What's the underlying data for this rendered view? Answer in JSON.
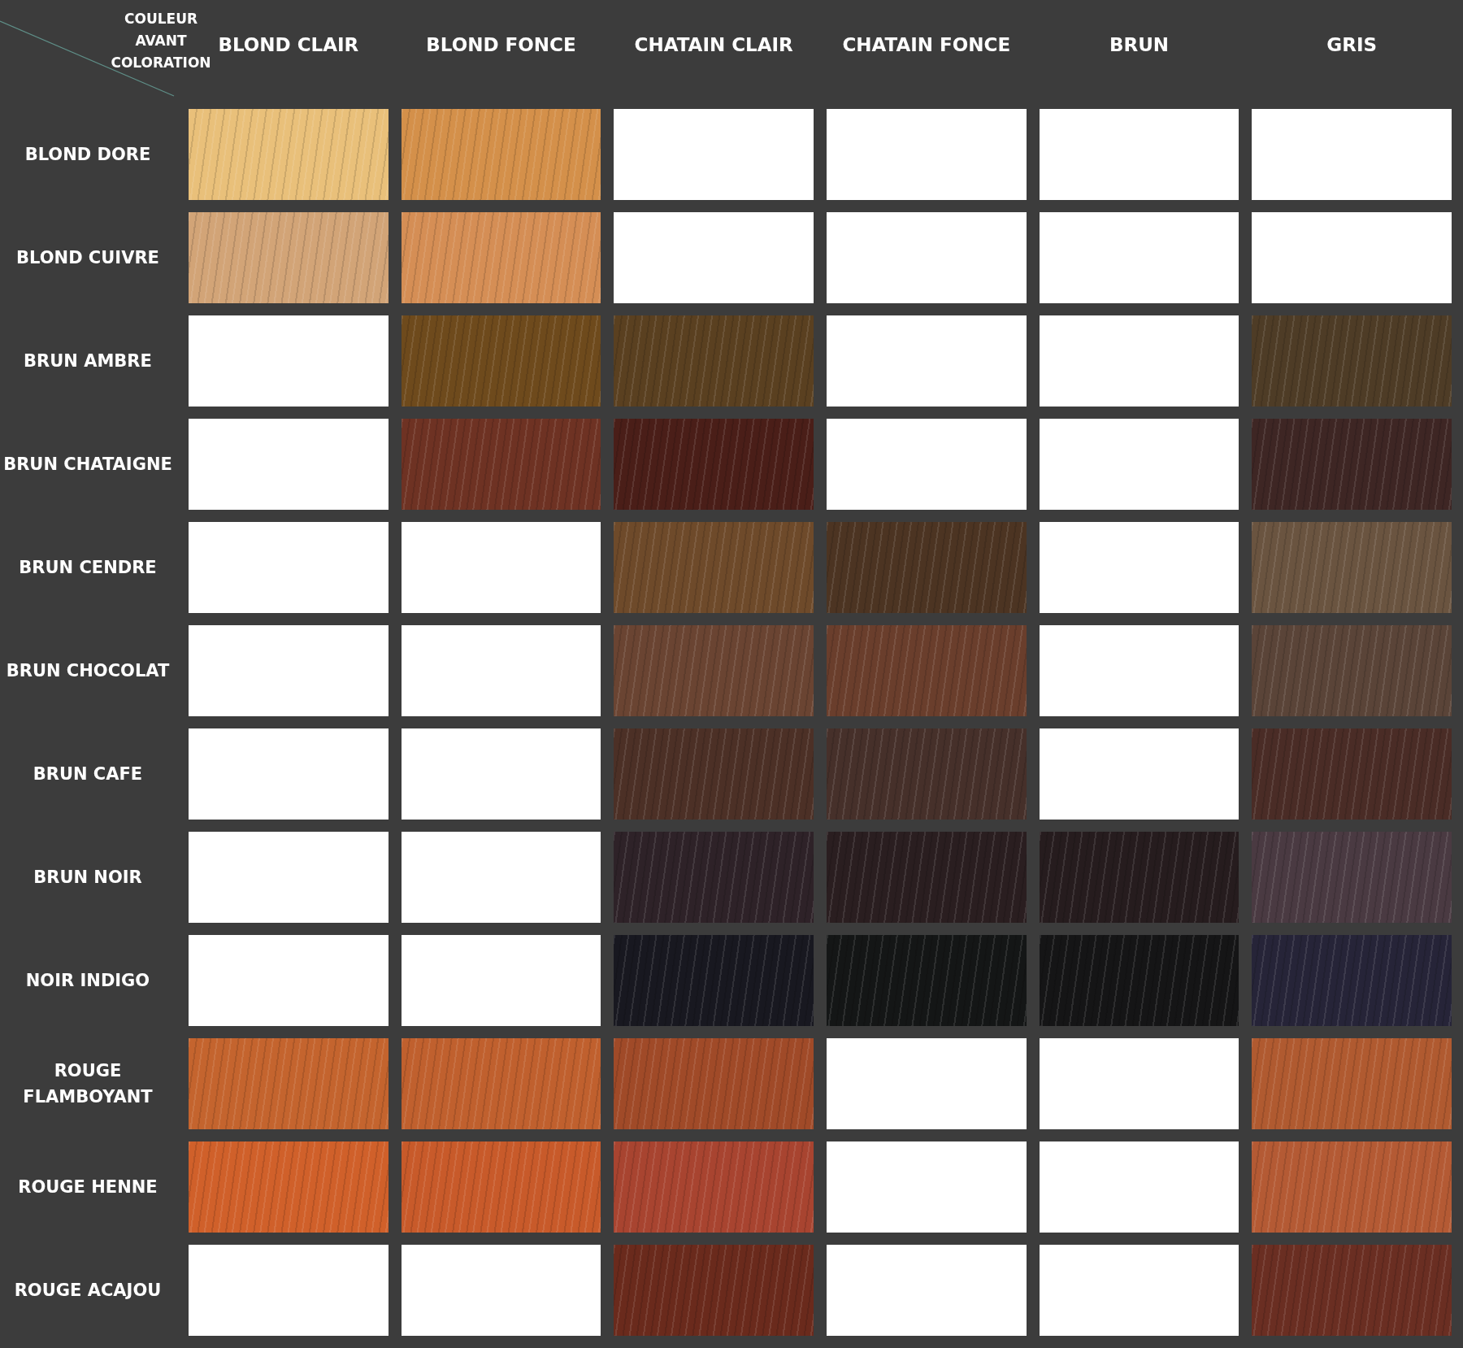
{
  "corner_label": "COULEUR AVANT COLORATION",
  "columns": [
    "BLOND CLAIR",
    "BLOND FONCE",
    "CHATAIN CLAIR",
    "CHATAIN FONCE",
    "BRUN",
    "GRIS"
  ],
  "rows": [
    {
      "label": "BLOND DORE",
      "cells": [
        {
          "kind": "swatch",
          "color": "#e9c07a"
        },
        {
          "kind": "swatch",
          "color": "#d4904a"
        },
        {
          "kind": "empty"
        },
        {
          "kind": "empty"
        },
        {
          "kind": "empty"
        },
        {
          "kind": "empty"
        }
      ]
    },
    {
      "label": "BLOND CUIVRE",
      "cells": [
        {
          "kind": "swatch",
          "color": "#d2a477"
        },
        {
          "kind": "swatch",
          "color": "#d58e55"
        },
        {
          "kind": "empty"
        },
        {
          "kind": "empty"
        },
        {
          "kind": "empty"
        },
        {
          "kind": "empty"
        }
      ]
    },
    {
      "label": "BRUN AMBRE",
      "cells": [
        {
          "kind": "empty"
        },
        {
          "kind": "swatch",
          "color": "#6e4a1c"
        },
        {
          "kind": "swatch",
          "color": "#5a4020"
        },
        {
          "kind": "empty"
        },
        {
          "kind": "empty"
        },
        {
          "kind": "swatch",
          "color": "#4e3c26"
        }
      ]
    },
    {
      "label": "BRUN CHATAIGNE",
      "cells": [
        {
          "kind": "empty"
        },
        {
          "kind": "swatch",
          "color": "#6e3223"
        },
        {
          "kind": "swatch",
          "color": "#4a1e18"
        },
        {
          "kind": "empty"
        },
        {
          "kind": "empty"
        },
        {
          "kind": "swatch",
          "color": "#3e2624"
        }
      ]
    },
    {
      "label": "BRUN CENDRE",
      "cells": [
        {
          "kind": "empty"
        },
        {
          "kind": "empty"
        },
        {
          "kind": "swatch",
          "color": "#6e4a2a"
        },
        {
          "kind": "swatch",
          "color": "#4c3422"
        },
        {
          "kind": "empty"
        },
        {
          "kind": "swatch",
          "color": "#6a5440"
        }
      ]
    },
    {
      "label": "BRUN CHOCOLAT",
      "cells": [
        {
          "kind": "empty"
        },
        {
          "kind": "empty"
        },
        {
          "kind": "swatch",
          "color": "#6a4432"
        },
        {
          "kind": "swatch",
          "color": "#6a3e2c"
        },
        {
          "kind": "empty"
        },
        {
          "kind": "swatch",
          "color": "#5a4438"
        }
      ]
    },
    {
      "label": "BRUN CAFE",
      "cells": [
        {
          "kind": "empty"
        },
        {
          "kind": "empty"
        },
        {
          "kind": "swatch",
          "color": "#4c3026"
        },
        {
          "kind": "swatch",
          "color": "#46302a"
        },
        {
          "kind": "empty"
        },
        {
          "kind": "swatch",
          "color": "#4a2c26"
        }
      ]
    },
    {
      "label": "BRUN NOIR",
      "cells": [
        {
          "kind": "empty"
        },
        {
          "kind": "empty"
        },
        {
          "kind": "swatch",
          "color": "#2e2228"
        },
        {
          "kind": "swatch",
          "color": "#2a1e20"
        },
        {
          "kind": "swatch",
          "color": "#261c1e"
        },
        {
          "kind": "swatch",
          "color": "#4a3a42"
        }
      ]
    },
    {
      "label": "NOIR INDIGO",
      "cells": [
        {
          "kind": "empty"
        },
        {
          "kind": "empty"
        },
        {
          "kind": "swatch",
          "color": "#181820"
        },
        {
          "kind": "swatch",
          "color": "#141616"
        },
        {
          "kind": "swatch",
          "color": "#151516"
        },
        {
          "kind": "swatch",
          "color": "#262438"
        }
      ]
    },
    {
      "label": "ROUGE FLAMBOYANT",
      "cells": [
        {
          "kind": "swatch",
          "color": "#c4642e"
        },
        {
          "kind": "swatch",
          "color": "#c0602e"
        },
        {
          "kind": "swatch",
          "color": "#a04a28"
        },
        {
          "kind": "empty"
        },
        {
          "kind": "empty"
        },
        {
          "kind": "swatch",
          "color": "#b05a30"
        }
      ]
    },
    {
      "label": "ROUGE HENNE",
      "cells": [
        {
          "kind": "swatch",
          "color": "#d0602a"
        },
        {
          "kind": "swatch",
          "color": "#c85a2a"
        },
        {
          "kind": "swatch",
          "color": "#a84430"
        },
        {
          "kind": "empty"
        },
        {
          "kind": "empty"
        },
        {
          "kind": "swatch",
          "color": "#b45a34"
        }
      ]
    },
    {
      "label": "ROUGE ACAJOU",
      "cells": [
        {
          "kind": "empty"
        },
        {
          "kind": "empty"
        },
        {
          "kind": "swatch",
          "color": "#6a2a1c"
        },
        {
          "kind": "empty"
        },
        {
          "kind": "empty"
        },
        {
          "kind": "swatch",
          "color": "#6a2e22"
        }
      ]
    }
  ]
}
